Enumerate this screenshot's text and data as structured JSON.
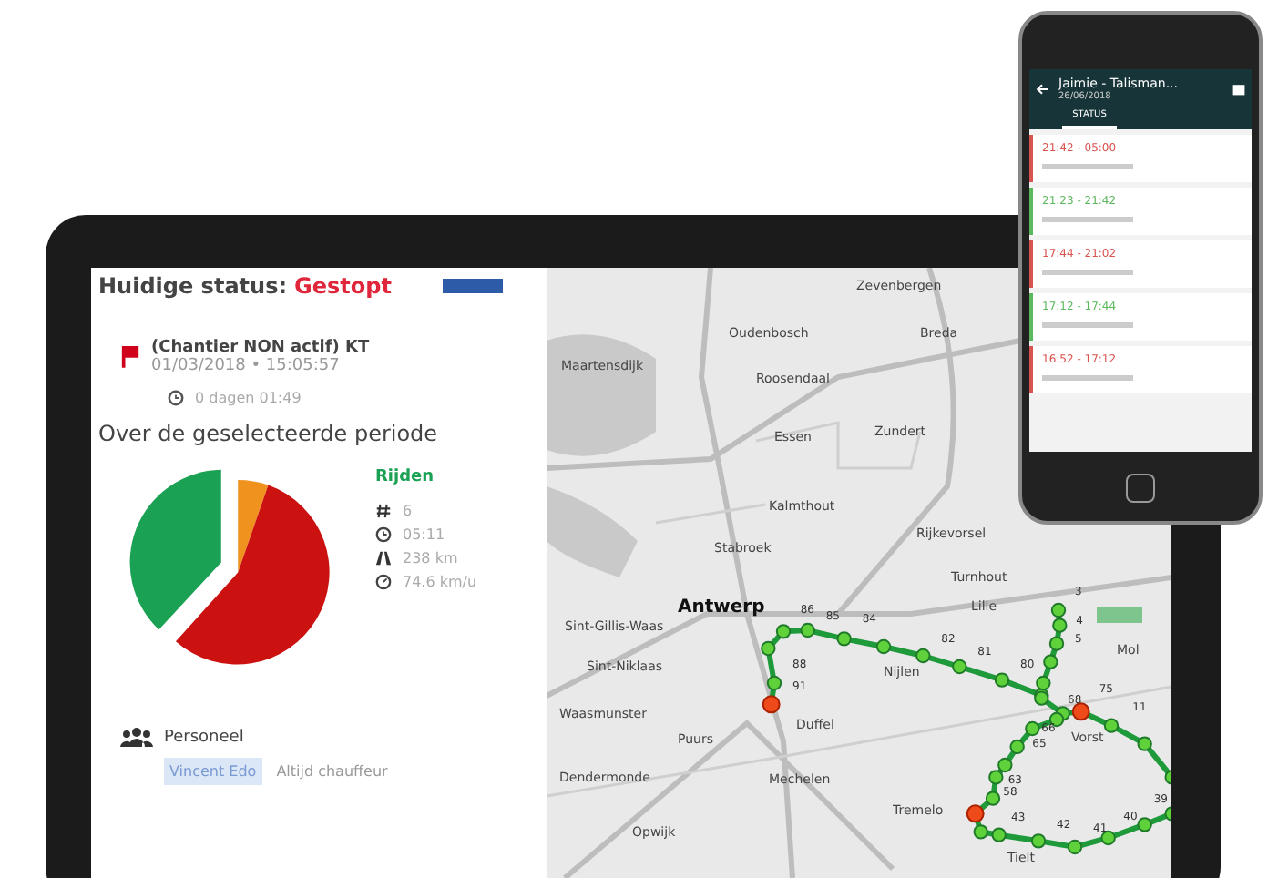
{
  "status_panel": {
    "status_label": "Huidige status:",
    "status_value": "Gestopt",
    "event": {
      "title": "(Chantier NON actif) KT",
      "datetime": "01/03/2018 • 15:05:57",
      "duration": "0 dagen 01:49"
    },
    "period_heading": "Over de geselecteerde periode",
    "legend_title": "Rijden",
    "stats": [
      {
        "kind": "count",
        "value": "6"
      },
      {
        "kind": "time",
        "value": "05:11"
      },
      {
        "kind": "distance",
        "value": "238 km"
      },
      {
        "kind": "speed",
        "value": "74.6 km/u"
      }
    ],
    "staff": {
      "heading": "Personeel",
      "chip": "Vincent Edo",
      "role": "Altijd chauffeur"
    }
  },
  "map": {
    "places": [
      {
        "name": "Zevenbergen"
      },
      {
        "name": "Oudenbosch"
      },
      {
        "name": "Breda"
      },
      {
        "name": "Maartensdijk"
      },
      {
        "name": "Roosendaal"
      },
      {
        "name": "Essen"
      },
      {
        "name": "Zundert"
      },
      {
        "name": "Kalmthout"
      },
      {
        "name": "Stabroek"
      },
      {
        "name": "Rijkevorsel"
      },
      {
        "name": "Turnhout"
      },
      {
        "name": "Antwerp",
        "major": true
      },
      {
        "name": "Lille"
      },
      {
        "name": "Sint-Gillis-Waas"
      },
      {
        "name": "Sint-Niklaas"
      },
      {
        "name": "Nijlen"
      },
      {
        "name": "Duffel"
      },
      {
        "name": "Puurs"
      },
      {
        "name": "Mol"
      },
      {
        "name": "Waasmunster"
      },
      {
        "name": "Dendermonde"
      },
      {
        "name": "Mechelen"
      },
      {
        "name": "Tremelo"
      },
      {
        "name": "Vorst"
      },
      {
        "name": "Opwijk"
      },
      {
        "name": "Tielt"
      }
    ],
    "route_labels": [
      "86",
      "85",
      "84",
      "82",
      "81",
      "80",
      "88",
      "91",
      "75",
      "68",
      "66",
      "65",
      "63",
      "58",
      "43",
      "42",
      "41",
      "40",
      "39",
      "11",
      "3",
      "4",
      "5"
    ]
  },
  "phone": {
    "title": "Jaimie - Talisman...",
    "date": "26/06/2018",
    "tab": "STATUS",
    "entries": [
      {
        "time": "21:42 - 05:00",
        "kind": "stopped"
      },
      {
        "time": "21:23 - 21:42",
        "kind": "driving"
      },
      {
        "time": "17:44 - 21:02",
        "kind": "stopped"
      },
      {
        "time": "17:12 - 17:44",
        "kind": "driving"
      },
      {
        "time": "16:52 - 17:12",
        "kind": "stopped"
      }
    ]
  }
}
